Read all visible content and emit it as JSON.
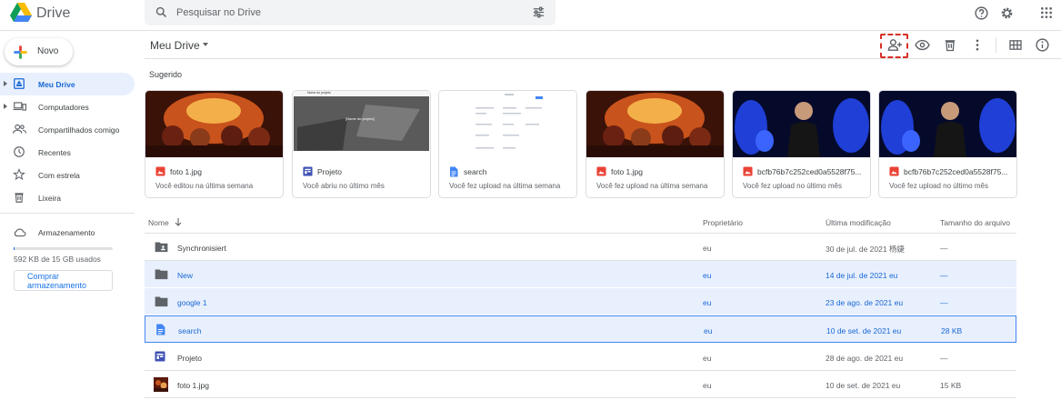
{
  "app": {
    "name": "Drive"
  },
  "search": {
    "placeholder": "Pesquisar no Drive"
  },
  "sidebar": {
    "new_label": "Novo",
    "items": [
      {
        "label": "Meu Drive"
      },
      {
        "label": "Computadores"
      },
      {
        "label": "Compartilhados comigo"
      },
      {
        "label": "Recentes"
      },
      {
        "label": "Com estrela"
      },
      {
        "label": "Lixeira"
      }
    ],
    "storage_label": "Armazenamento",
    "storage_used_text": "592 KB de 15 GB usados",
    "storage_used_fraction": 4e-05,
    "buy_label": "Comprar armazenamento"
  },
  "header": {
    "title": "Meu Drive"
  },
  "suggested": {
    "label": "Sugerido",
    "cards": [
      {
        "name": "foto 1.jpg",
        "desc": "Você editou na última semana",
        "icon": "image-icon"
      },
      {
        "name": "Projeto",
        "desc": "Você abriu no último mês",
        "icon": "form-icon"
      },
      {
        "name": "search",
        "desc": "Você fez upload na última semana",
        "icon": "doc-icon"
      },
      {
        "name": "foto 1.jpg",
        "desc": "Você fez upload na última semana",
        "icon": "image-icon"
      },
      {
        "name": "bcfb76b7c252ced0a5528f75...",
        "desc": "Você fez upload no último mês",
        "icon": "image-icon"
      },
      {
        "name": "bcfb76b7c252ced0a5528f75...",
        "desc": "Você fez upload no último mês",
        "icon": "image-icon"
      }
    ],
    "thumb_texts": {
      "site_header": "Nome do projeto",
      "site_banner": "[Nome do projeto]"
    }
  },
  "list": {
    "columns": {
      "name": "Nome",
      "owner": "Proprietário",
      "modified": "Última modificação",
      "size": "Tamanho do arquivo"
    },
    "rows": [
      {
        "name": "Synchronisiert",
        "owner": "eu",
        "modified": "30 de jul. de 2021 杨婕",
        "size": "—",
        "icon": "shared-folder-icon"
      },
      {
        "name": "New",
        "owner": "eu",
        "modified": "14 de jul. de 2021 eu",
        "size": "—",
        "icon": "folder-icon"
      },
      {
        "name": "google 1",
        "owner": "eu",
        "modified": "23 de ago. de 2021 eu",
        "size": "—",
        "icon": "folder-icon"
      },
      {
        "name": "search",
        "owner": "eu",
        "modified": "10 de set. de 2021 eu",
        "size": "28 KB",
        "icon": "doc-icon"
      },
      {
        "name": "Projeto",
        "owner": "eu",
        "modified": "28 de ago. de 2021 eu",
        "size": "—",
        "icon": "form-icon"
      },
      {
        "name": "foto 1.jpg",
        "owner": "eu",
        "modified": "10 de set. de 2021 eu",
        "size": "15 KB",
        "icon": "image-thumb-icon"
      }
    ]
  },
  "colors": {
    "accent": "#1a73e8",
    "selected_bg": "#e8f0fe",
    "highlight": "#d93025"
  }
}
